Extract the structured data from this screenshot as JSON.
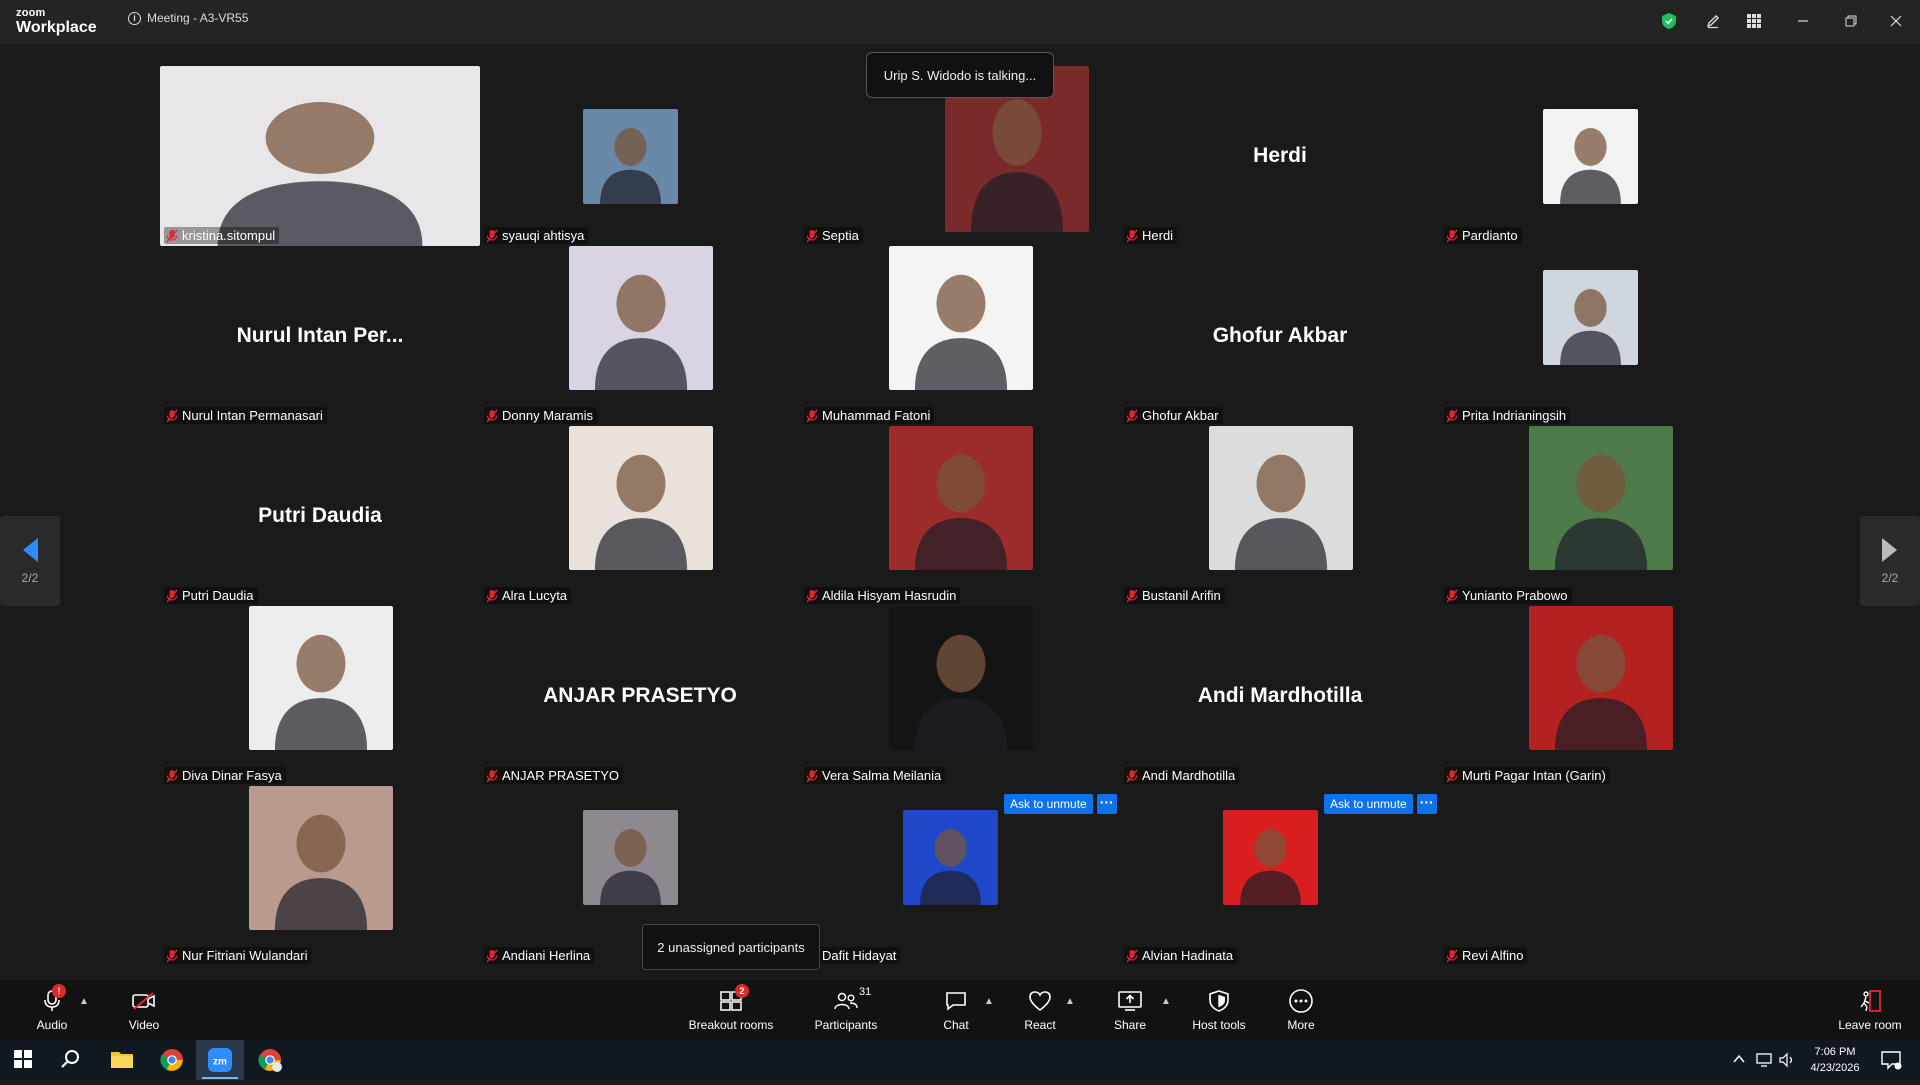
{
  "app": {
    "brand_small": "zoom",
    "brand_large": "Workplace",
    "meeting_title": "Meeting - A3-VR55"
  },
  "talking_indicator": "Urip S. Widodo is talking...",
  "pager": {
    "left": "2/2",
    "right": "2/2"
  },
  "participants": [
    {
      "name": "kristina.sitompul",
      "display": "video",
      "color": "#e9e6ea"
    },
    {
      "name": "syauqi ahtisya",
      "display": "photo",
      "color": "#6a88a8"
    },
    {
      "name": "Septia",
      "display": "photo",
      "color": "#7a2a2a"
    },
    {
      "name": "Herdi",
      "display": "name",
      "big_name": "Herdi"
    },
    {
      "name": "Pardianto",
      "display": "photo",
      "color": "#f2f2f2"
    },
    {
      "name": "Nurul Intan Permanasari",
      "display": "name",
      "big_name": "Nurul Intan Per..."
    },
    {
      "name": "Donny Maramis",
      "display": "photo",
      "color": "#d9d3e2"
    },
    {
      "name": "Muhammad Fatoni",
      "display": "photo",
      "color": "#f4f4f4"
    },
    {
      "name": "Ghofur Akbar",
      "display": "name",
      "big_name": "Ghofur Akbar"
    },
    {
      "name": "Prita Indrianingsih",
      "display": "photo",
      "color": "#cfd6dd"
    },
    {
      "name": "Putri Daudia",
      "display": "name",
      "big_name": "Putri Daudia"
    },
    {
      "name": "Alra Lucyta",
      "display": "photo",
      "color": "#e8e2db"
    },
    {
      "name": "Aldila Hisyam Hasrudin",
      "display": "photo",
      "color": "#9c2b2b"
    },
    {
      "name": "Bustanil Arifin",
      "display": "photo",
      "color": "#dcdcdc"
    },
    {
      "name": "Yunianto Prabowo",
      "display": "photo",
      "color": "#4f7a4a"
    },
    {
      "name": "Diva Dinar Fasya",
      "display": "photo",
      "color": "#ededed"
    },
    {
      "name": "ANJAR PRASETYO",
      "display": "name",
      "big_name": "ANJAR PRASETYO"
    },
    {
      "name": "Vera Salma Meilania",
      "display": "photo",
      "color": "#141414"
    },
    {
      "name": "Andi Mardhotilla",
      "display": "name",
      "big_name": "Andi Mardhotilla"
    },
    {
      "name": "Murti Pagar Intan (Garin)",
      "display": "photo",
      "color": "#b32121"
    },
    {
      "name": "Nur Fitriani Wulandari",
      "display": "photo",
      "color": "#b89a8e"
    },
    {
      "name": "Andiani Herlina",
      "display": "photo",
      "color": "#8e8890"
    },
    {
      "name": "Dafit Hidayat",
      "display": "photo",
      "color": "#1f47c9"
    },
    {
      "name": "Alvian Hadinata",
      "display": "photo",
      "color": "#d81e1e"
    },
    {
      "name": "Revi Alfino",
      "display": "video",
      "color": "#1c1c1c"
    }
  ],
  "ask_to_unmute": {
    "label": "Ask to unmute",
    "more": "···"
  },
  "tooltip": "2 unassigned participants",
  "toolbar": {
    "audio": "Audio",
    "audio_badge": "!",
    "video": "Video",
    "breakout": "Breakout rooms",
    "breakout_badge": "2",
    "participants": "Participants",
    "participants_count": "31",
    "chat": "Chat",
    "react": "React",
    "share": "Share",
    "host_tools": "Host tools",
    "more": "More",
    "leave": "Leave room"
  },
  "taskbar": {
    "time": "7:06 PM",
    "date": "4/23/2026"
  },
  "colors": {
    "accent": "#0e72ed",
    "danger": "#e02828",
    "shield": "#1fbf5f"
  }
}
